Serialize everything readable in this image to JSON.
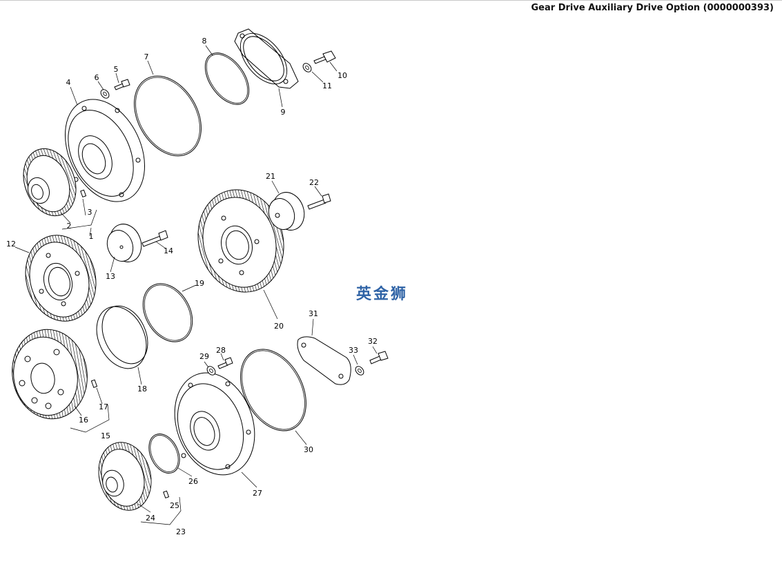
{
  "header": {
    "title": "Gear Drive Auxiliary Drive Option (0000000393)"
  },
  "watermark": "英金狮",
  "callouts": [
    "1",
    "2",
    "3",
    "4",
    "5",
    "6",
    "7",
    "8",
    "9",
    "10",
    "11",
    "12",
    "13",
    "14",
    "15",
    "16",
    "17",
    "18",
    "19",
    "20",
    "21",
    "22",
    "23",
    "24",
    "25",
    "26",
    "27",
    "28",
    "29",
    "30",
    "31",
    "32",
    "33"
  ]
}
